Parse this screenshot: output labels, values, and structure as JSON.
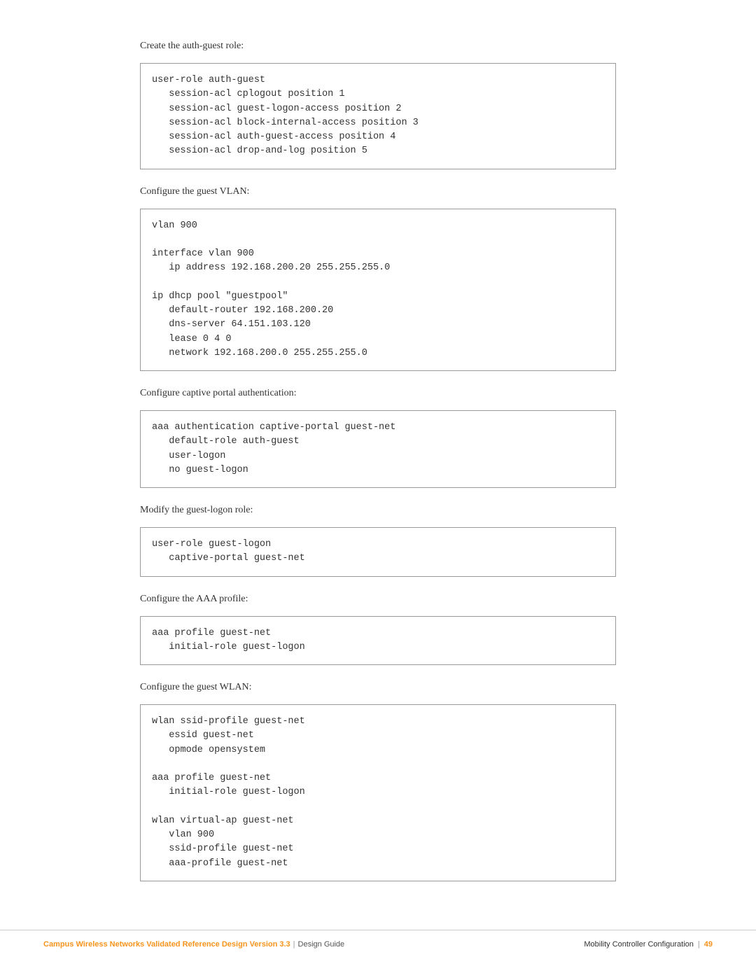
{
  "sections": [
    {
      "label": "Create the auth-guest role:",
      "code": "user-role auth-guest\n   session-acl cplogout position 1\n   session-acl guest-logon-access position 2\n   session-acl block-internal-access position 3\n   session-acl auth-guest-access position 4\n   session-acl drop-and-log position 5"
    },
    {
      "label": "Configure the guest VLAN:",
      "code": "vlan 900\n\ninterface vlan 900\n   ip address 192.168.200.20 255.255.255.0\n\nip dhcp pool \"guestpool\"\n   default-router 192.168.200.20\n   dns-server 64.151.103.120\n   lease 0 4 0\n   network 192.168.200.0 255.255.255.0"
    },
    {
      "label": "Configure captive portal authentication:",
      "code": "aaa authentication captive-portal guest-net\n   default-role auth-guest\n   user-logon\n   no guest-logon"
    },
    {
      "label": "Modify the guest-logon role:",
      "code": "user-role guest-logon\n   captive-portal guest-net"
    },
    {
      "label": "Configure the AAA profile:",
      "code": "aaa profile guest-net\n   initial-role guest-logon"
    },
    {
      "label": "Configure the guest WLAN:",
      "code": "wlan ssid-profile guest-net\n   essid guest-net\n   opmode opensystem\n\naaa profile guest-net\n   initial-role guest-logon\n\nwlan virtual-ap guest-net\n   vlan 900\n   ssid-profile guest-net\n   aaa-profile guest-net"
    }
  ],
  "footer": {
    "title": "Campus Wireless Networks Validated Reference Design Version 3.3",
    "subtitle": "Design Guide",
    "section": "Mobility Controller Configuration",
    "page": "49"
  }
}
